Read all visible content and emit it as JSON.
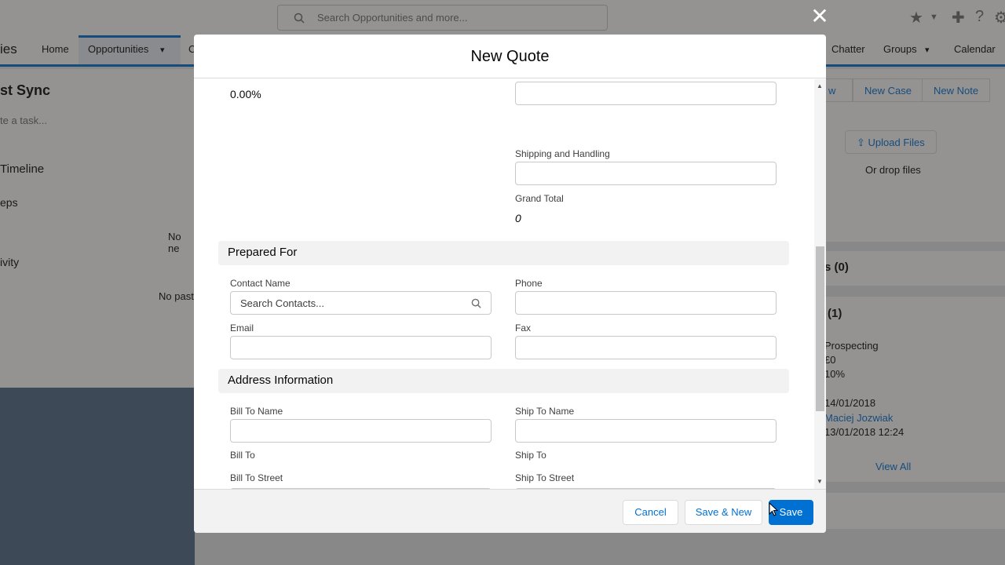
{
  "background": {
    "search_placeholder": "Search Opportunities and more...",
    "nav": {
      "partial_left": "ies",
      "home": "Home",
      "opportunities": "Opportunities",
      "partial_c": "C",
      "chatter": "Chatter",
      "groups": "Groups",
      "calendar": "Calendar"
    },
    "left_panel": {
      "title_partial": "st Sync",
      "task_placeholder": "te a task...",
      "timeline": "Timeline",
      "steps_partial": "eps",
      "no_next_partial": "No ne",
      "activity_partial": "ivity",
      "no_past_partial": "No past"
    },
    "right_panel": {
      "btn_partial": "w",
      "new_case": "New Case",
      "new_note": "New Note",
      "upload_files": "Upload Files",
      "or_drop_files": "Or drop files",
      "related_a": "s (0)",
      "related_b": "(1)",
      "stage": "Prospecting",
      "amount": "£0",
      "probability": "10%",
      "close_date": "14/01/2018",
      "owner": "Maciej Jozwiak",
      "modified": "13/01/2018 12:24",
      "view_all": "View All"
    }
  },
  "modal": {
    "title": "New Quote",
    "discount_value": "0.00%",
    "shipping_label": "Shipping and Handling",
    "grand_total_label": "Grand Total",
    "grand_total_value": "0",
    "prepared_for": {
      "section_title": "Prepared For",
      "contact_name_label": "Contact Name",
      "contact_placeholder": "Search Contacts...",
      "phone_label": "Phone",
      "email_label": "Email",
      "fax_label": "Fax"
    },
    "address": {
      "section_title": "Address Information",
      "bill_to_name_label": "Bill To Name",
      "ship_to_name_label": "Ship To Name",
      "bill_to_label": "Bill To",
      "ship_to_label": "Ship To",
      "bill_to_street_label": "Bill To Street",
      "ship_to_street_label": "Ship To Street"
    },
    "footer": {
      "cancel": "Cancel",
      "save_new": "Save & New",
      "save": "Save"
    }
  },
  "colors": {
    "brand": "#0070d2",
    "overlay": "#2b2826"
  }
}
